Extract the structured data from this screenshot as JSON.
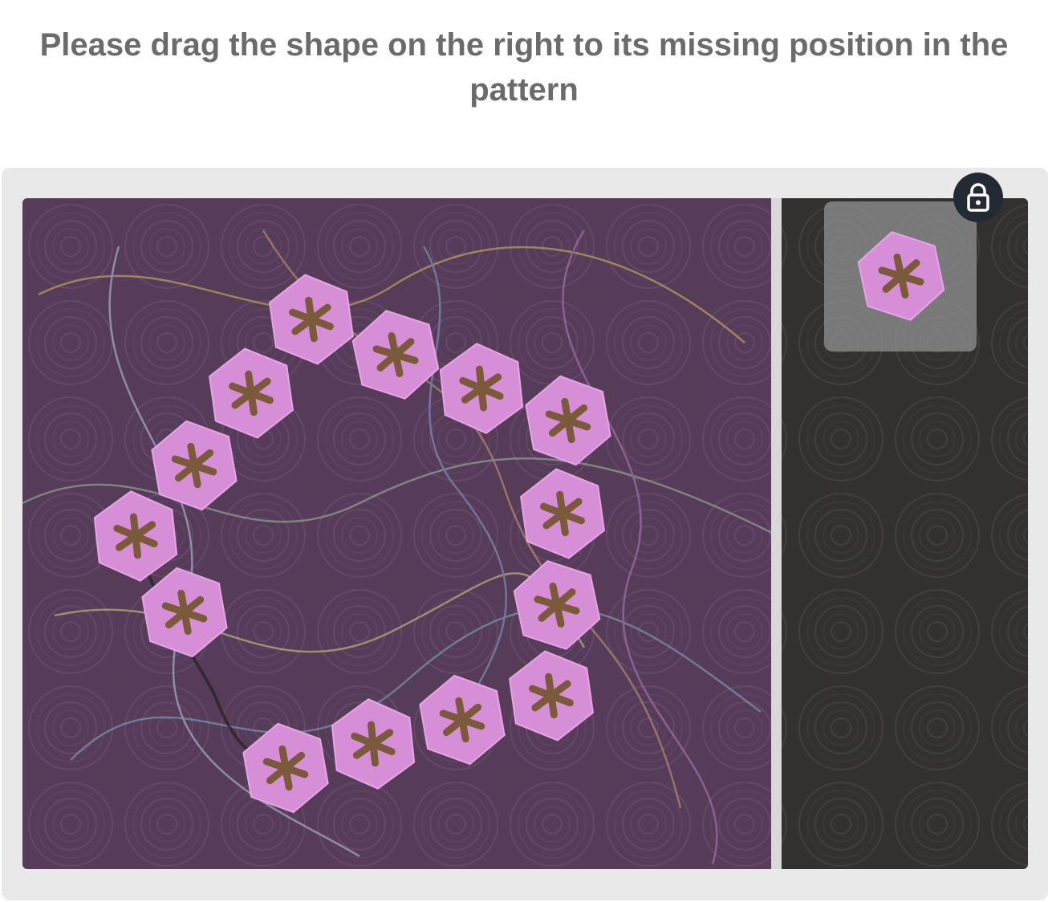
{
  "instruction": "Please drag the shape on the right to its missing position in the pattern",
  "colors": {
    "instruction_text": "#6b6b6b",
    "panel_background": "#e9e9e9",
    "scene_background": "#4e3a56",
    "drop_zone_background": "#333030",
    "divider": "#d8d8d8",
    "hexagon_fill": "#d68fd6",
    "asterisk": "#7a5a3a",
    "lock_button": "#232a33"
  },
  "icons": {
    "lock": "lock-icon",
    "shape": "hexagon-asterisk-icon"
  }
}
